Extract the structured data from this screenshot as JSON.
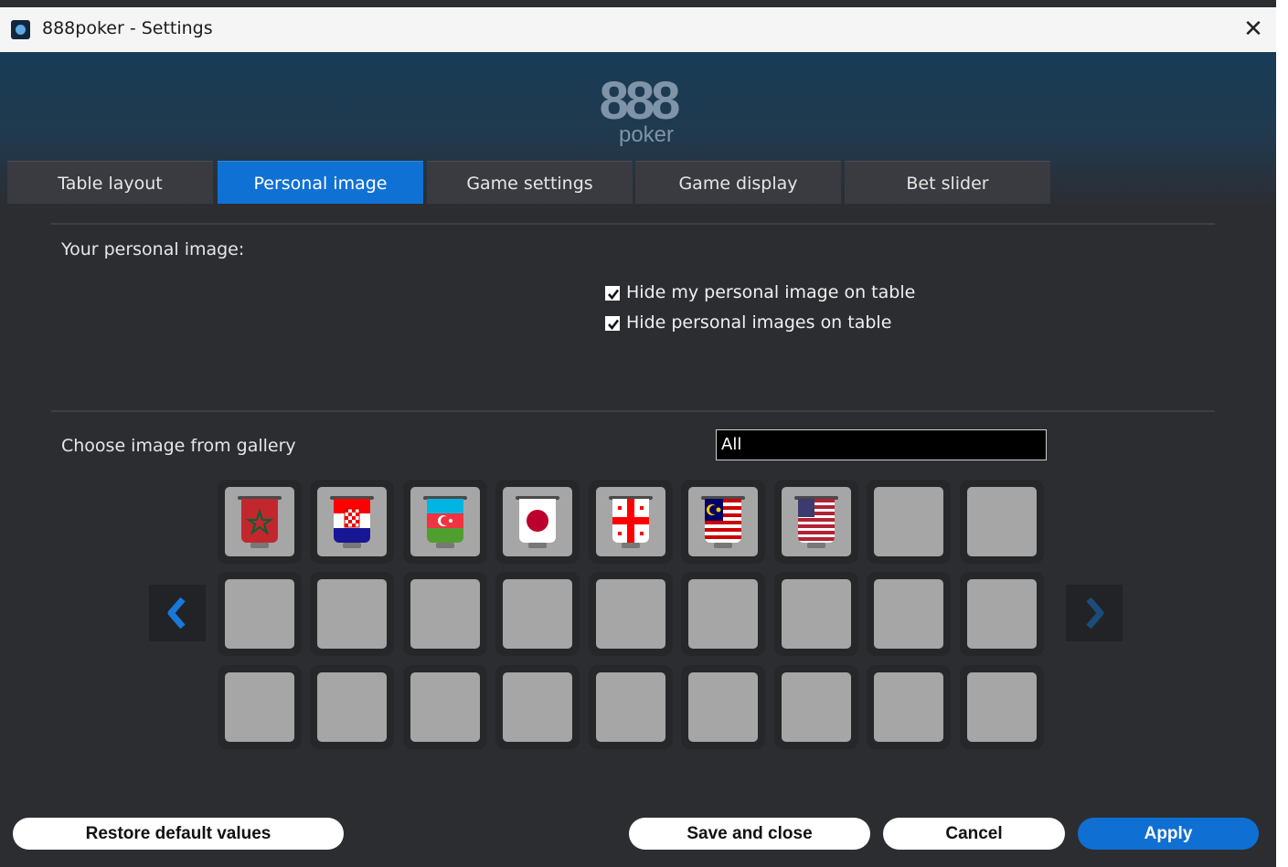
{
  "window": {
    "title": "888poker - Settings",
    "close_glyph": "✕",
    "icon": "888poker-app-icon"
  },
  "logo": {
    "number": "888",
    "word": "poker"
  },
  "tabs": [
    {
      "label": "Table layout",
      "active": false
    },
    {
      "label": "Personal image",
      "active": true
    },
    {
      "label": "Game settings",
      "active": false
    },
    {
      "label": "Game display",
      "active": false
    },
    {
      "label": "Bet slider",
      "active": false
    }
  ],
  "personal": {
    "heading": "Your personal image:",
    "options": [
      {
        "label": "Hide my personal image on table",
        "checked": true
      },
      {
        "label": "Hide personal images on table",
        "checked": true
      }
    ]
  },
  "gallery": {
    "label": "Choose image from gallery",
    "filter_value": "All",
    "prev_icon": "chevron-left-icon",
    "next_icon": "chevron-right-icon",
    "images": [
      "morocco-flag",
      "croatia-flag",
      "azerbaijan-flag",
      "japan-flag",
      "georgia-flag",
      "malaysia-flag",
      "usa-flag",
      "empty",
      "empty",
      "empty",
      "empty",
      "empty",
      "empty",
      "empty",
      "empty",
      "empty",
      "empty",
      "empty",
      "empty",
      "empty",
      "empty",
      "empty",
      "empty",
      "empty",
      "empty",
      "empty",
      "empty"
    ]
  },
  "buttons": {
    "restore": "Restore default values",
    "save_close": "Save and close",
    "cancel": "Cancel",
    "apply": "Apply"
  },
  "colors": {
    "accent": "#1071d4",
    "background": "#2c2d31",
    "tile": "#a6a6a6"
  }
}
